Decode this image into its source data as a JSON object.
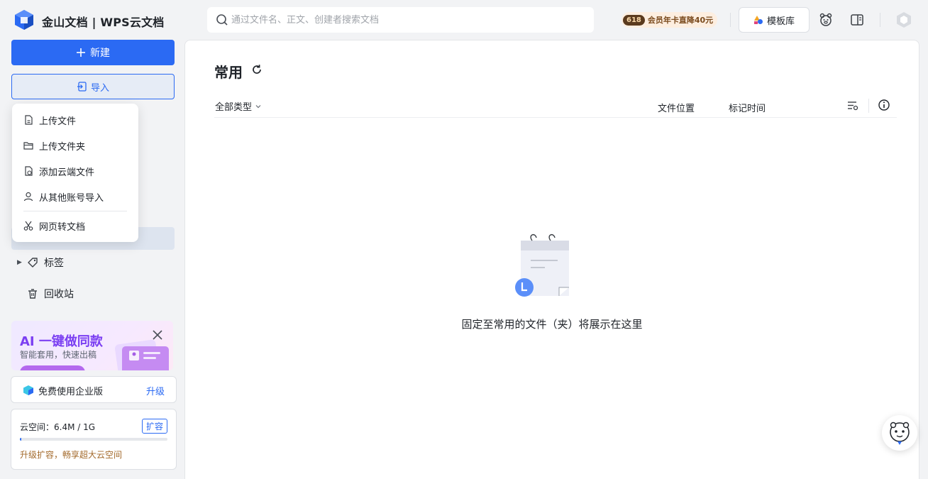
{
  "header": {
    "brand": "金山文档 | WPS云文档",
    "search_placeholder": "通过文件名、正文、创建者搜索文档",
    "promo": {
      "number": "618",
      "text": "会员年卡直降40元"
    },
    "template_button": "模板库"
  },
  "sidebar": {
    "new_button": "新建",
    "import_button": "导入",
    "import_menu": [
      {
        "label": "上传文件",
        "icon": "file-upload-icon"
      },
      {
        "label": "上传文件夹",
        "icon": "folder-upload-icon"
      },
      {
        "label": "添加云端文件",
        "icon": "cloud-file-add-icon"
      },
      {
        "label": "从其他账号导入",
        "icon": "user-import-icon"
      },
      {
        "label": "网页转文档",
        "icon": "scissors-icon"
      }
    ],
    "items": [
      {
        "label": "标签",
        "icon": "tag-icon"
      },
      {
        "label": "回收站",
        "icon": "trash-icon"
      }
    ],
    "ai_banner": {
      "title": "AI 一键做同款",
      "subtitle": "智能套用，快速出稿"
    },
    "enterprise": {
      "label": "免费使用企业版",
      "action": "升级"
    },
    "storage": {
      "label": "云空间：6.4M / 1G",
      "expand": "扩容",
      "used_fraction": 0.006,
      "tip": "升级扩容，畅享超大云空间"
    }
  },
  "main": {
    "title": "常用",
    "columns": {
      "type_filter": "全部类型",
      "location": "文件位置",
      "mark_time": "标记时间"
    },
    "empty_text": "固定至常用的文件（夹）将展示在这里"
  },
  "colors": {
    "accent": "#2b6af3",
    "ai_purple": "#7b3ff2"
  }
}
